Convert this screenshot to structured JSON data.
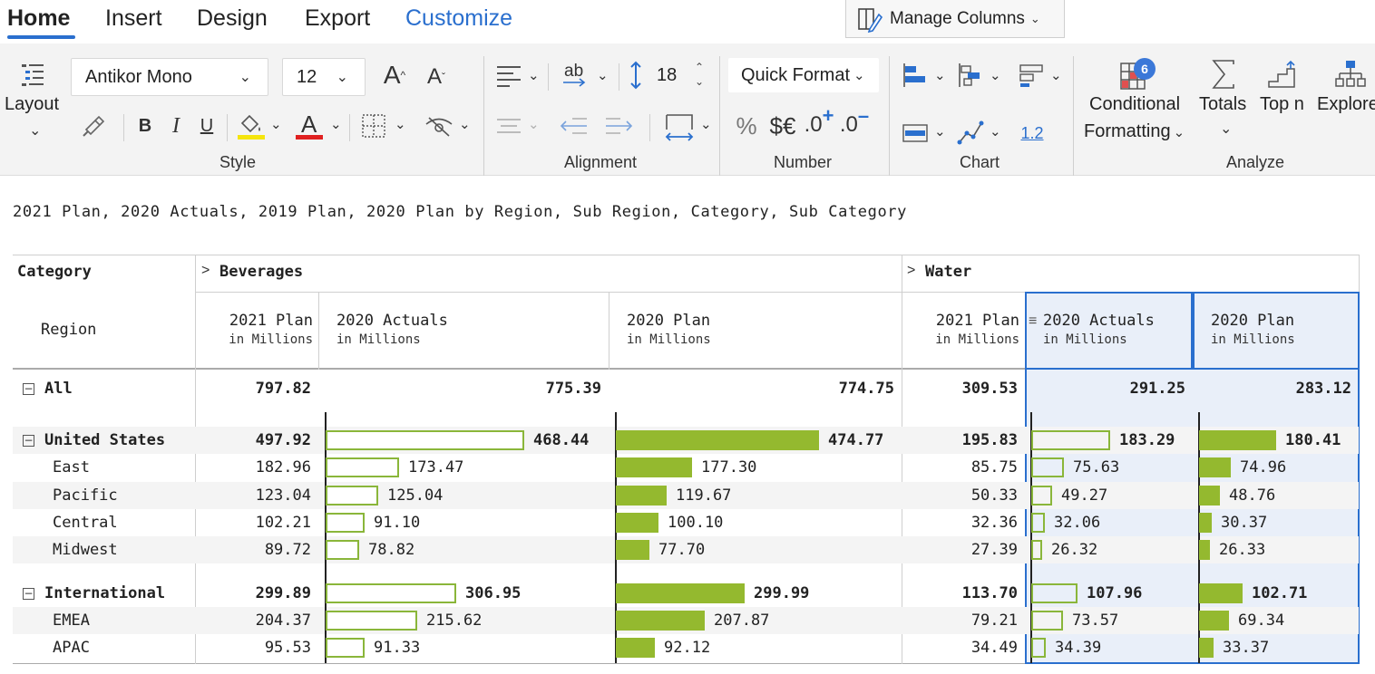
{
  "tabs": [
    {
      "label": "Home",
      "active": true
    },
    {
      "label": "Insert"
    },
    {
      "label": "Design"
    },
    {
      "label": "Export"
    },
    {
      "label": "Customize",
      "accent": "#2a6fce"
    }
  ],
  "manage_columns_label": "Manage Columns",
  "ribbon": {
    "layout_label": "Layout",
    "font_name": "Antikor Mono",
    "font_size": "12",
    "row_height": "18",
    "quick_format_label": "Quick Format",
    "number_samples": {
      "percent": "%",
      "currency": "$€",
      "inc_decimals": ".0",
      "dec_decimals": ".0"
    },
    "decimal_sample": "1.2",
    "conditional_formatting_line1": "Conditional",
    "conditional_formatting_line2": "Formatting",
    "conditional_badge": "6",
    "totals_label": "Totals",
    "topn_label": "Top n",
    "explore_label": "Explore",
    "groups": {
      "style": "Style",
      "alignment": "Alignment",
      "number": "Number",
      "chart": "Chart",
      "analyze": "Analyze"
    },
    "colors": {
      "highlight": "#f5e50d",
      "font_color": "#e02020",
      "accent": "#2a6fce",
      "icon_blue": "#2a6fce"
    }
  },
  "table_title": "2021 Plan, 2020 Actuals, 2019 Plan, 2020 Plan by Region, Sub Region, Category, Sub Category",
  "table": {
    "category_label": "Category",
    "region_label": "Region",
    "groups": [
      "Beverages",
      "Water"
    ],
    "unit": "in Millions",
    "columns": [
      {
        "title": "2021 Plan",
        "group": "Beverages",
        "style": "num"
      },
      {
        "title": "2020 Actuals",
        "group": "Beverages",
        "style": "outline"
      },
      {
        "title": "2020 Plan",
        "group": "Beverages",
        "style": "fill"
      },
      {
        "title": "2021 Plan",
        "group": "Water",
        "style": "num"
      },
      {
        "title": "2020 Actuals",
        "group": "Water",
        "style": "outline"
      },
      {
        "title": "2020 Plan",
        "group": "Water",
        "style": "fill"
      }
    ],
    "rows": [
      {
        "label": "All",
        "level": 0,
        "bold": true,
        "values": [
          "797.82",
          "775.39",
          "774.75",
          "309.53",
          "291.25",
          "283.12"
        ],
        "nums": [
          797.82,
          775.39,
          774.75,
          309.53,
          291.25,
          283.12
        ],
        "bars": false
      },
      {
        "label": "United States",
        "level": 0,
        "bold": true,
        "values": [
          "497.92",
          "468.44",
          "474.77",
          "195.83",
          "183.29",
          "180.41"
        ],
        "nums": [
          497.92,
          468.44,
          474.77,
          195.83,
          183.29,
          180.41
        ],
        "bars": true
      },
      {
        "label": "East",
        "level": 1,
        "values": [
          "182.96",
          "173.47",
          "177.30",
          "85.75",
          "75.63",
          "74.96"
        ],
        "nums": [
          182.96,
          173.47,
          177.3,
          85.75,
          75.63,
          74.96
        ],
        "bars": true
      },
      {
        "label": "Pacific",
        "level": 1,
        "values": [
          "123.04",
          "125.04",
          "119.67",
          "50.33",
          "49.27",
          "48.76"
        ],
        "nums": [
          123.04,
          125.04,
          119.67,
          50.33,
          49.27,
          48.76
        ],
        "bars": true
      },
      {
        "label": "Central",
        "level": 1,
        "values": [
          "102.21",
          "91.10",
          "100.10",
          "32.36",
          "32.06",
          "30.37"
        ],
        "nums": [
          102.21,
          91.1,
          100.1,
          32.36,
          32.06,
          30.37
        ],
        "bars": true
      },
      {
        "label": "Midwest",
        "level": 1,
        "values": [
          "89.72",
          "78.82",
          "77.70",
          "27.39",
          "26.32",
          "26.33"
        ],
        "nums": [
          89.72,
          78.82,
          77.7,
          27.39,
          26.32,
          26.33
        ],
        "bars": true
      },
      {
        "label": "International",
        "level": 0,
        "bold": true,
        "values": [
          "299.89",
          "306.95",
          "299.99",
          "113.70",
          "107.96",
          "102.71"
        ],
        "nums": [
          299.89,
          306.95,
          299.99,
          113.7,
          107.96,
          102.71
        ],
        "bars": true
      },
      {
        "label": "EMEA",
        "level": 1,
        "values": [
          "204.37",
          "215.62",
          "207.87",
          "79.21",
          "73.57",
          "69.34"
        ],
        "nums": [
          204.37,
          215.62,
          207.87,
          79.21,
          73.57,
          69.34
        ],
        "bars": true
      },
      {
        "label": "APAC",
        "level": 1,
        "values": [
          "95.53",
          "91.33",
          "92.12",
          "34.49",
          "34.39",
          "33.37"
        ],
        "nums": [
          95.53,
          91.33,
          92.12,
          34.49,
          34.39,
          33.37
        ],
        "bars": true
      }
    ],
    "colors": {
      "bar": "#94b92f",
      "bar_outline": "#8ab63a",
      "selection": "#2a6fce",
      "selection_bg": "#e9eff9",
      "zebra": "#f4f4f4"
    }
  }
}
